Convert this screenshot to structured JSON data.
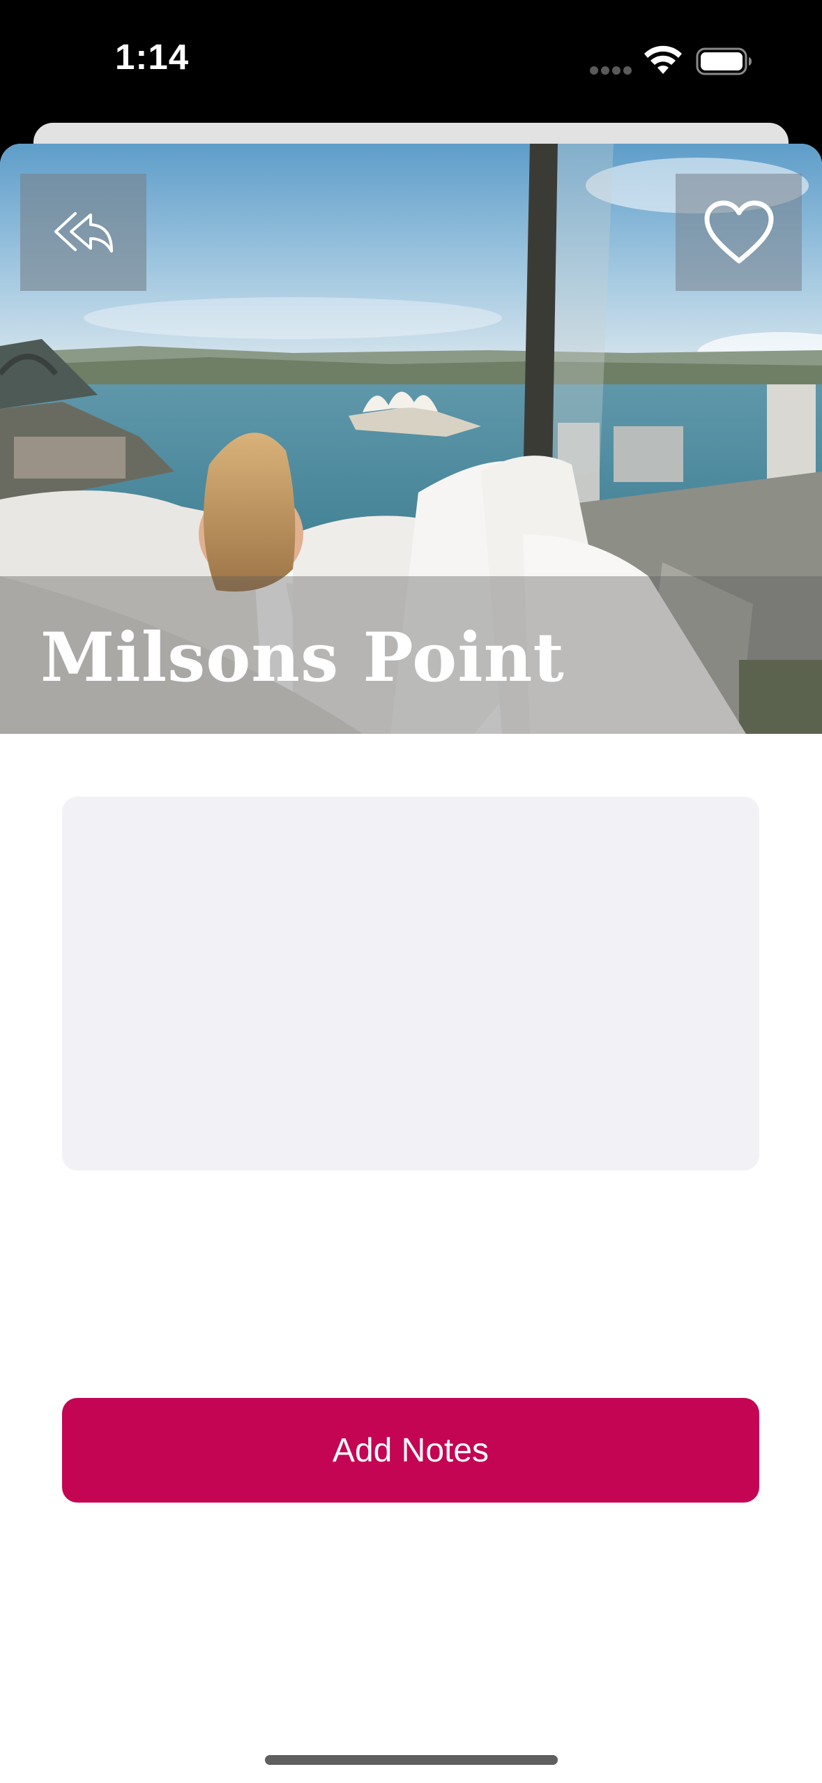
{
  "status_bar": {
    "time": "1:14",
    "icons": [
      "cellular-signal-icon",
      "wifi-icon",
      "battery-icon"
    ]
  },
  "hero": {
    "title": "Milsons Point",
    "photo": "harbour-view-bedroom-photo",
    "back_icon": "reply-all-icon",
    "favorite_icon": "heart-outline-icon"
  },
  "notes": {
    "content": ""
  },
  "actions": {
    "add_notes_label": "Add Notes"
  },
  "colors": {
    "accent": "#c40554",
    "notes_background": "#f2f1f6",
    "status_bar_background": "#000000"
  }
}
